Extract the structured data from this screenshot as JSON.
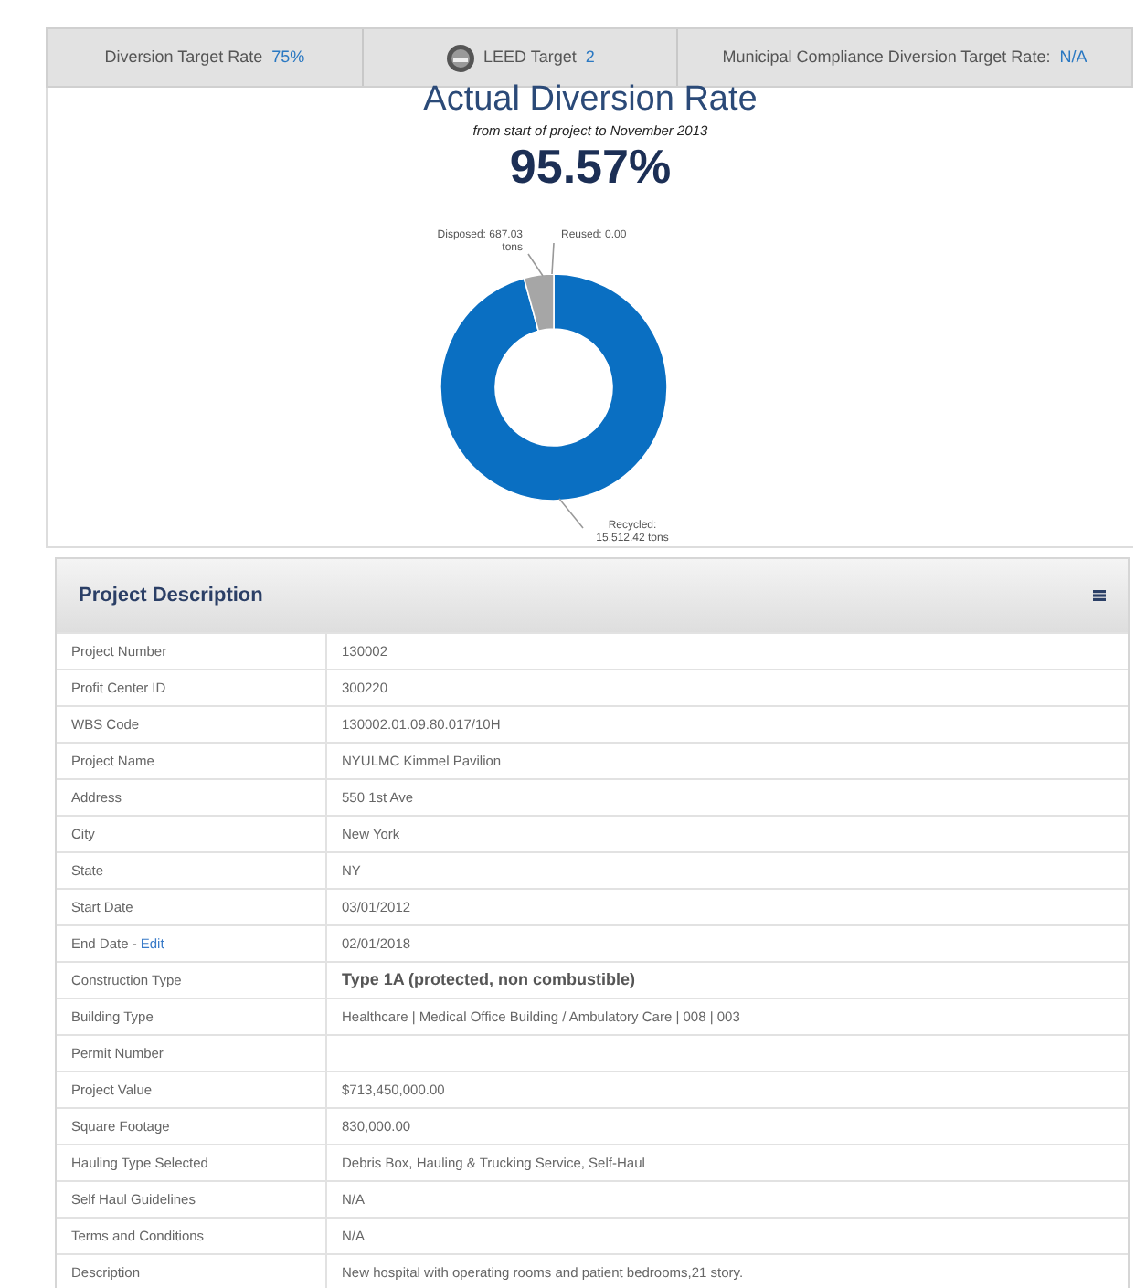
{
  "targets": [
    {
      "label": "Diversion Target Rate",
      "value": "75%",
      "kind": "plain"
    },
    {
      "label": "LEED Target",
      "value": "2",
      "kind": "badge"
    },
    {
      "label": "Municipal Compliance Diversion Target Rate:",
      "value": "N/A",
      "kind": "plain"
    }
  ],
  "diversion": {
    "title": "Actual Diversion Rate",
    "subtitle": "from start of project to November 2013",
    "rate": "95.57%",
    "chart_data": {
      "type": "donut",
      "categories": [
        "Recycled: 15,512.42 tons",
        "Disposed: 687.03 tons",
        "Reused: 0.00"
      ],
      "values": [
        15512.42,
        687.03,
        0
      ]
    }
  },
  "project": {
    "title": "Project Description",
    "rows": [
      {
        "label": "Project Number",
        "value": "130002",
        "bold": false
      },
      {
        "label": "Profit Center ID",
        "value": "300220",
        "bold": false
      },
      {
        "label": "WBS Code",
        "value": "130002.01.09.80.017/10H",
        "bold": false
      },
      {
        "label": "Project Name",
        "value": "NYULMC Kimmel Pavilion",
        "bold": false
      },
      {
        "label": "Address",
        "value": "550 1st Ave",
        "bold": false
      },
      {
        "label": "City",
        "value": "New York",
        "bold": false
      },
      {
        "label": "State",
        "value": "NY",
        "bold": false
      },
      {
        "label": "Start Date",
        "value": "03/01/2012",
        "bold": false
      },
      {
        "label": "End Date -",
        "link": "Edit",
        "value": "02/01/2018",
        "bold": false
      },
      {
        "label": "Construction Type",
        "value": "Type 1A (protected, non combustible)",
        "bold": true
      },
      {
        "label": "Building Type",
        "value": "Healthcare | Medical Office Building / Ambulatory Care | 008 | 003",
        "bold": false
      },
      {
        "label": "Permit Number"
      },
      {
        "label": "Project Value",
        "value": "$713,450,000.00",
        "bold": false
      },
      {
        "label": "Square Footage",
        "value": "830,000.00",
        "bold": false
      },
      {
        "label": "Hauling Type Selected",
        "value": "Debris Box, Hauling & Trucking Service, Self-Haul",
        "bold": false
      },
      {
        "label": "Self Haul Guidelines",
        "value": "N/A",
        "bold": false
      },
      {
        "label": "Terms and Conditions",
        "value": "N/A",
        "bold": false
      },
      {
        "label": "Description",
        "value": "New hospital with operating rooms and patient bedrooms,21  story.",
        "bold": false
      }
    ]
  }
}
